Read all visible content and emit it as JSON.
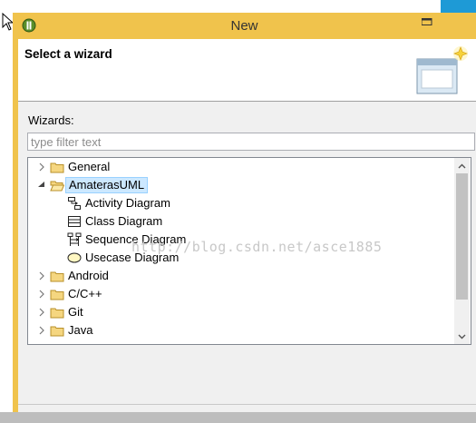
{
  "window": {
    "title": "New"
  },
  "banner": {
    "title": "Select a wizard"
  },
  "wizards_label": "Wizards:",
  "filter": {
    "placeholder": "type filter text",
    "value": ""
  },
  "tree": {
    "items": [
      {
        "label": "General",
        "expanded": false,
        "icon": "folder-icon"
      },
      {
        "label": "AmaterasUML",
        "expanded": true,
        "selected": true,
        "icon": "folder-open-icon"
      },
      {
        "label": "Activity Diagram",
        "icon": "activity-diagram-icon"
      },
      {
        "label": "Class Diagram",
        "icon": "class-diagram-icon"
      },
      {
        "label": "Sequence Diagram",
        "icon": "sequence-diagram-icon"
      },
      {
        "label": "Usecase Diagram",
        "icon": "usecase-diagram-icon"
      },
      {
        "label": "Android",
        "expanded": false,
        "icon": "folder-icon"
      },
      {
        "label": "C/C++",
        "expanded": false,
        "icon": "folder-icon"
      },
      {
        "label": "Git",
        "expanded": false,
        "icon": "folder-icon"
      },
      {
        "label": "Java",
        "expanded": false,
        "icon": "folder-icon"
      }
    ]
  },
  "watermark": "http://blog.csdn.net/asce1885",
  "colors": {
    "titlebar": "#f0c34c",
    "selection": "#cce8ff",
    "folder": "#e8c060"
  }
}
